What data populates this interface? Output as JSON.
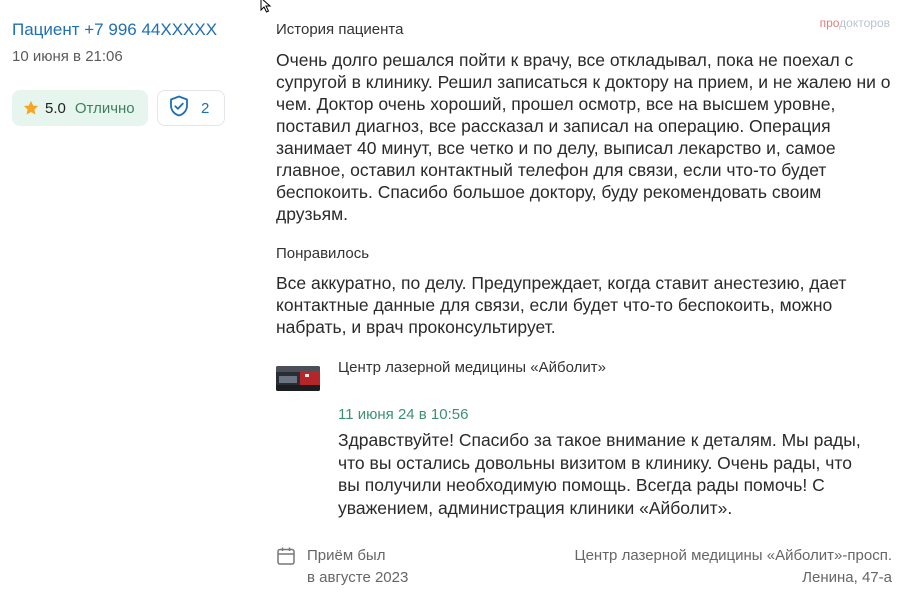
{
  "patient": {
    "name": "Пациент +7 996 44XXXXX",
    "date": "10 июня в 21:06",
    "rating_value": "5.0",
    "rating_text": "Отлично",
    "verify_count": "2"
  },
  "logo": {
    "part1": "про",
    "part2": "докторов"
  },
  "review": {
    "history_title": "История пациента",
    "history_text": "Очень долго решался пойти к врачу, все откладывал, пока не поехал с супругой в клинику. Решил записаться к доктору на прием, и не жалею ни о чем. Доктор очень хороший, прошел осмотр, все на высшем уровне, поставил диагноз, все рассказал и записал на операцию. Операция занимает 40 минут, все четко и по делу, выписал лекарство и, самое главное, оставил контактный телефон для связи, если что-то будет беспокоить. Спасибо большое доктору, буду рекомендовать своим друзьям.",
    "liked_title": "Понравилось",
    "liked_text": "Все аккуратно, по делу. Предупреждает, когда ставит анестезию, дает контактные данные для связи, если будет что-то беспокоить, можно набрать, и врач проконсультирует."
  },
  "reply": {
    "clinic_name": "Центр лазерной медицины «Айболит»",
    "date": "11 июня 24 в 10:56",
    "text": "Здравствуйте! Спасибо за такое внимание к деталям. Мы рады, что вы остались довольны визитом в клинику. Очень рады, что вы получили необходимую помощь. Всегда рады помочь! С уважением, администрация клиники «Айболит»."
  },
  "visit": {
    "line1": "Приём был",
    "line2": "в августе 2023"
  },
  "location": {
    "line1": "Центр лазерной медицины «Айболит»-просп.",
    "line2": "Ленина, 47-а"
  },
  "icons": {
    "rating": "star-icon",
    "verify": "shield-check-icon",
    "visit": "calendar-icon",
    "cursor": "mouse-cursor-icon"
  },
  "colors": {
    "link_blue": "#1f6fb5",
    "rating_bg": "#e6f6ee",
    "star": "#f5a623",
    "reply_date": "#3f8f78",
    "logo_red": "#e07c7c"
  }
}
